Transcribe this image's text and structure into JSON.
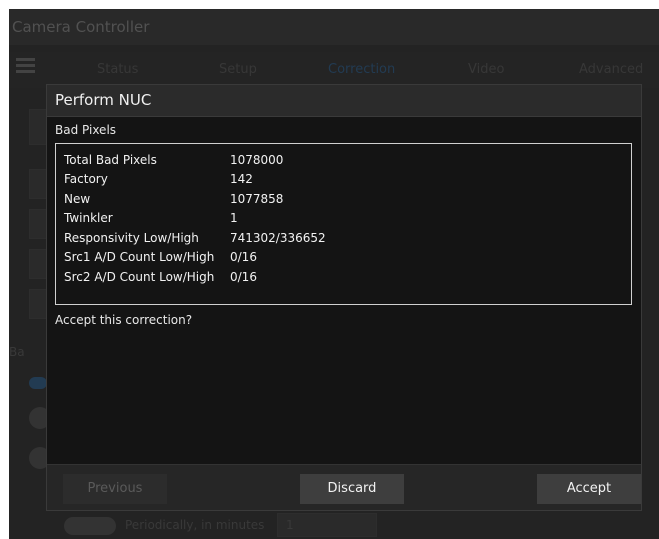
{
  "app": {
    "title": "Camera Controller"
  },
  "nav": {
    "tabs": [
      {
        "label": "Status"
      },
      {
        "label": "Setup"
      },
      {
        "label": "Correction"
      },
      {
        "label": "Video"
      },
      {
        "label": "Advanced"
      }
    ],
    "active_tab": "Correction"
  },
  "background": {
    "periodic_label": "Periodically, in minutes",
    "periodic_value": "1",
    "partial_label_1": "Ba"
  },
  "dialog": {
    "title": "Perform NUC",
    "section_title": "Bad Pixels",
    "stats": [
      {
        "label": "Total Bad Pixels",
        "value": "1078000"
      },
      {
        "label": "Factory",
        "value": "142"
      },
      {
        "label": "New",
        "value": "1077858"
      },
      {
        "label": "Twinkler",
        "value": "1"
      },
      {
        "label": "Responsivity Low/High",
        "value": "741302/336652"
      },
      {
        "label": "Src1 A/D Count Low/High",
        "value": "0/16"
      },
      {
        "label": "Src2 A/D Count Low/High",
        "value": "0/16"
      }
    ],
    "question": "Accept this correction?",
    "buttons": {
      "previous": "Previous",
      "discard": "Discard",
      "accept": "Accept"
    }
  },
  "colors": {
    "dialog_bg": "#141414",
    "header_bg": "#2b2b2b",
    "footer_bg": "#262626",
    "active_tab": "#2e4f6e"
  }
}
